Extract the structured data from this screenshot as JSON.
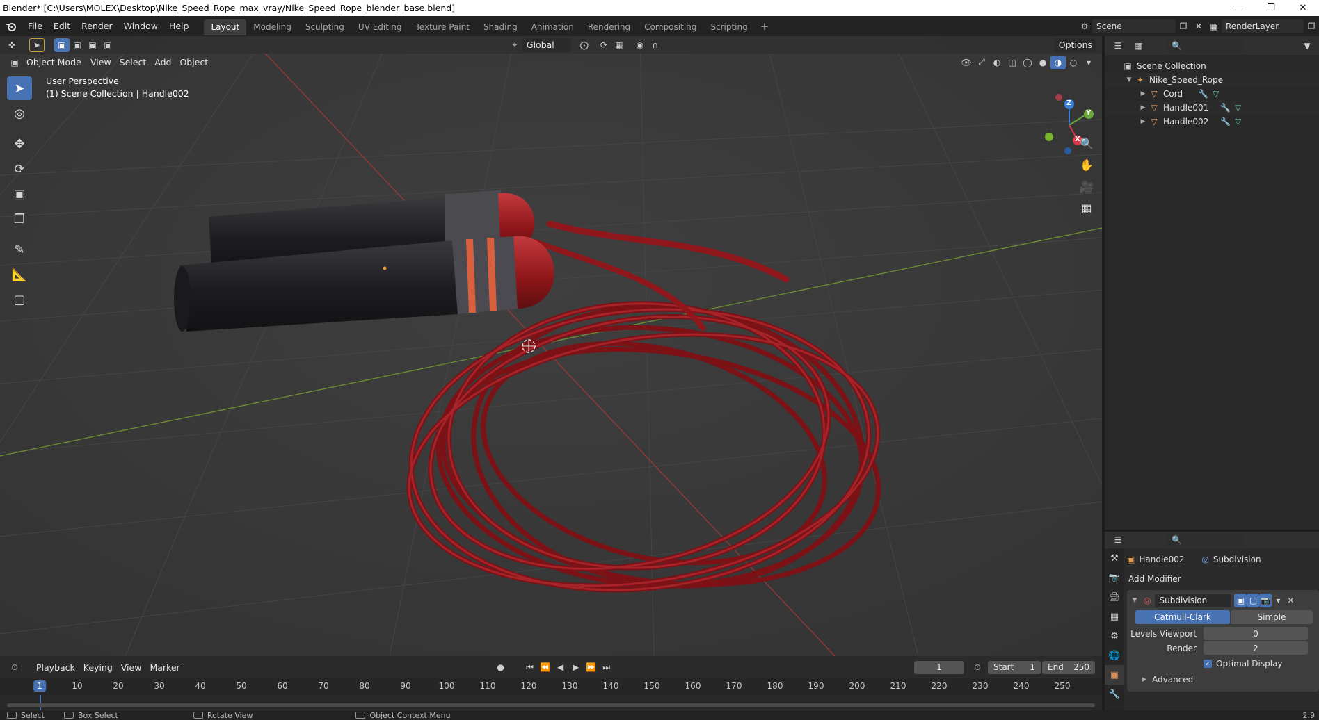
{
  "window": {
    "title": "Blender* [C:\\Users\\MOLEX\\Desktop\\Nike_Speed_Rope_max_vray/Nike_Speed_Rope_blender_base.blend]"
  },
  "menu": [
    "File",
    "Edit",
    "Render",
    "Window",
    "Help"
  ],
  "workspaces": [
    {
      "label": "Layout",
      "active": true
    },
    {
      "label": "Modeling"
    },
    {
      "label": "Sculpting"
    },
    {
      "label": "UV Editing"
    },
    {
      "label": "Texture Paint"
    },
    {
      "label": "Shading"
    },
    {
      "label": "Animation"
    },
    {
      "label": "Rendering"
    },
    {
      "label": "Compositing"
    },
    {
      "label": "Scripting"
    }
  ],
  "topbar": {
    "scene": "Scene",
    "render_layer": "RenderLayer"
  },
  "viewport_header": {
    "mode": "Object Mode",
    "menus": [
      "View",
      "Select",
      "Add",
      "Object"
    ],
    "transform_orientation": "Global",
    "options": "Options"
  },
  "viewport_info": {
    "line1": "User Perspective",
    "line2": "(1) Scene Collection | Handle002"
  },
  "gizmo": {
    "z": "Z",
    "y": "Y",
    "x": "X"
  },
  "outliner": {
    "root": "Scene Collection",
    "collection": "Nike_Speed_Rope",
    "objects": [
      "Cord",
      "Handle001",
      "Handle002"
    ]
  },
  "properties": {
    "object": "Handle002",
    "modifier_context": "Subdivision",
    "add_modifier": "Add Modifier",
    "modifier_name": "Subdivision",
    "type_options": [
      "Catmull-Clark",
      "Simple"
    ],
    "levels_viewport_label": "Levels Viewport",
    "levels_viewport_value": "0",
    "render_label": "Render",
    "render_value": "2",
    "optimal_display": "Optimal Display",
    "advanced": "Advanced"
  },
  "timeline": {
    "menus": [
      "Playback",
      "Keying",
      "View",
      "Marker"
    ],
    "current_frame": "1",
    "start_label": "Start",
    "start_value": "1",
    "end_label": "End",
    "end_value": "250",
    "ticks": [
      "10",
      "20",
      "30",
      "40",
      "50",
      "60",
      "70",
      "80",
      "90",
      "100",
      "110",
      "120",
      "130",
      "140",
      "150",
      "160",
      "170",
      "180",
      "190",
      "200",
      "210",
      "220",
      "230",
      "240",
      "250"
    ],
    "ruler_current": "1"
  },
  "statusbar": {
    "select": "Select",
    "box_select": "Box Select",
    "rotate": "Rotate View",
    "context": "Object Context Menu",
    "version": "2.9"
  },
  "colors": {
    "accent": "#4772b3",
    "rope": "#a3161e",
    "handle": "#1f1f22"
  }
}
